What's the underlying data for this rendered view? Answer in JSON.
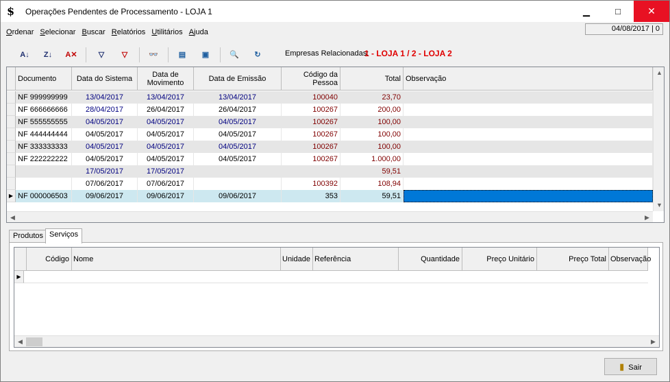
{
  "window": {
    "title": "Operações Pendentes de Processamento - LOJA 1",
    "app_icon": "dollar-sign-icon",
    "min": "▁",
    "max": "□",
    "close": "✕"
  },
  "menu": [
    "Ordenar",
    "Selecionar",
    "Buscar",
    "Relatórios",
    "Utilitários",
    "Ajuda"
  ],
  "datebox": "04/08/2017 | 0",
  "toolbar": {
    "buttons": [
      {
        "name": "sort-asc-icon",
        "glyph": "A↓"
      },
      {
        "name": "sort-desc-icon",
        "glyph": "Z↓"
      },
      {
        "name": "clear-sort-icon",
        "glyph": "A✕"
      },
      {
        "name": "filter-icon",
        "glyph": "▽"
      },
      {
        "name": "clear-filter-icon",
        "glyph": "▽"
      },
      {
        "name": "binoculars-icon",
        "glyph": "👓"
      },
      {
        "name": "columns-icon",
        "glyph": "▤"
      },
      {
        "name": "export-icon",
        "glyph": "▣"
      },
      {
        "name": "preview-icon",
        "glyph": "🔍"
      },
      {
        "name": "refresh-icon",
        "glyph": "↻"
      }
    ],
    "empresas_label": "Empresas Relacionadas:",
    "empresas_value": "1 - LOJA 1 / 2 - LOJA 2"
  },
  "grid1": {
    "headers": [
      "Documento",
      "Data do Sistema",
      "Data de Movimento",
      "Data de Emissão",
      "Código da Pessoa",
      "Total",
      "Observação"
    ],
    "rows": [
      {
        "doc": "NF 999999999",
        "sis": "13/04/2017",
        "mov": "13/04/2017",
        "emi": "13/04/2017",
        "cod": "100040",
        "total": "23,70",
        "obs": ""
      },
      {
        "doc": "NF 666666666",
        "sis": "28/04/2017",
        "mov": "26/04/2017",
        "emi": "26/04/2017",
        "cod": "100267",
        "total": "200,00",
        "obs": ""
      },
      {
        "doc": "NF 555555555",
        "sis": "04/05/2017",
        "mov": "04/05/2017",
        "emi": "04/05/2017",
        "cod": "100267",
        "total": "100,00",
        "obs": ""
      },
      {
        "doc": "NF 444444444",
        "sis": "04/05/2017",
        "mov": "04/05/2017",
        "emi": "04/05/2017",
        "cod": "100267",
        "total": "100,00",
        "obs": ""
      },
      {
        "doc": "NF 333333333",
        "sis": "04/05/2017",
        "mov": "04/05/2017",
        "emi": "04/05/2017",
        "cod": "100267",
        "total": "100,00",
        "obs": ""
      },
      {
        "doc": "NF 222222222",
        "sis": "04/05/2017",
        "mov": "04/05/2017",
        "emi": "04/05/2017",
        "cod": "100267",
        "total": "1.000,00",
        "obs": ""
      },
      {
        "doc": "",
        "sis": "17/05/2017",
        "mov": "17/05/2017",
        "emi": "",
        "cod": "",
        "total": "59,51",
        "obs": ""
      },
      {
        "doc": "",
        "sis": "07/06/2017",
        "mov": "07/06/2017",
        "emi": "",
        "cod": "100392",
        "total": "108,94",
        "obs": ""
      },
      {
        "doc": "NF 000006503",
        "sis": "09/06/2017",
        "mov": "09/06/2017",
        "emi": "09/06/2017",
        "cod": "353",
        "total": "59,51",
        "obs": ""
      }
    ]
  },
  "tabs": [
    "Produtos",
    "Serviços"
  ],
  "grid2": {
    "headers": [
      "",
      "Código",
      "Nome",
      "Unidade",
      "Referência",
      "Quantidade",
      "Preço Unitário",
      "Preço Total",
      "Observação"
    ]
  },
  "sair": "Sair",
  "colors": {
    "selected_row": "#cde8f0",
    "focused_cell": "#0078d7",
    "alt_row": "#e6e6e6",
    "blue_text": "#000080",
    "red_text": "#800000",
    "empresas": "#e00000"
  }
}
